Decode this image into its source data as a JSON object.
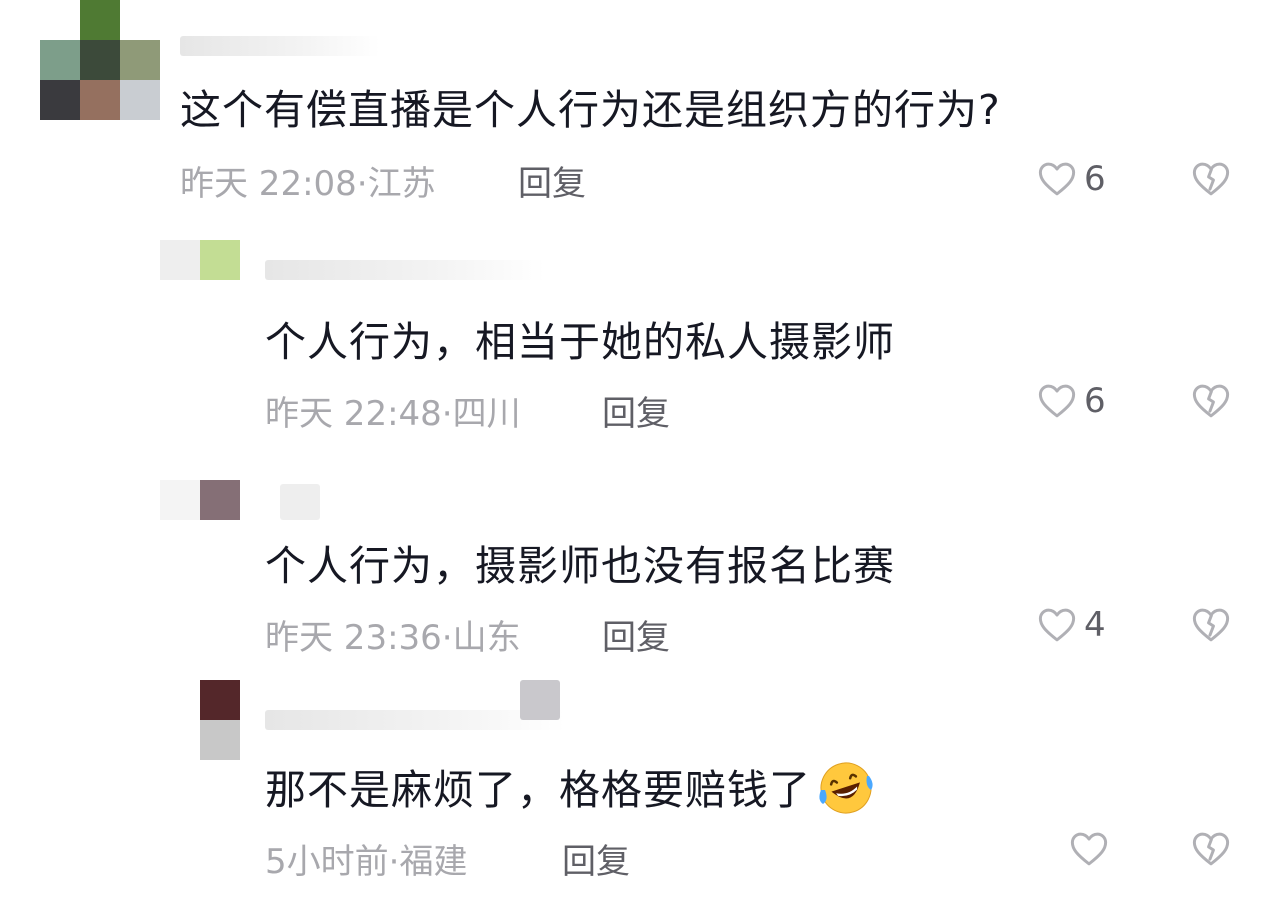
{
  "comments": [
    {
      "text": "这个有偿直播是个人行为还是组织方的行为?",
      "time": "昨天 22:08·江苏",
      "reply_label": "回复",
      "likes": "6"
    },
    {
      "text": "个人行为，相当于她的私人摄影师",
      "time": "昨天 22:48·四川",
      "reply_label": "回复",
      "likes": "6"
    },
    {
      "text": "个人行为，摄影师也没有报名比赛",
      "time": "昨天 23:36·山东",
      "reply_label": "回复",
      "likes": "4"
    },
    {
      "text": "那不是麻烦了，格格要赔钱了",
      "time": "5小时前·福建",
      "reply_label": "回复",
      "likes": ""
    }
  ],
  "icons": {
    "like": "heart-outline-icon",
    "dislike": "broken-heart-icon",
    "emoji": "rolling-laughing-emoji-icon"
  },
  "colors": {
    "text": "#161823",
    "meta": "#a8a8ad",
    "icon": "#b0b0b5"
  }
}
